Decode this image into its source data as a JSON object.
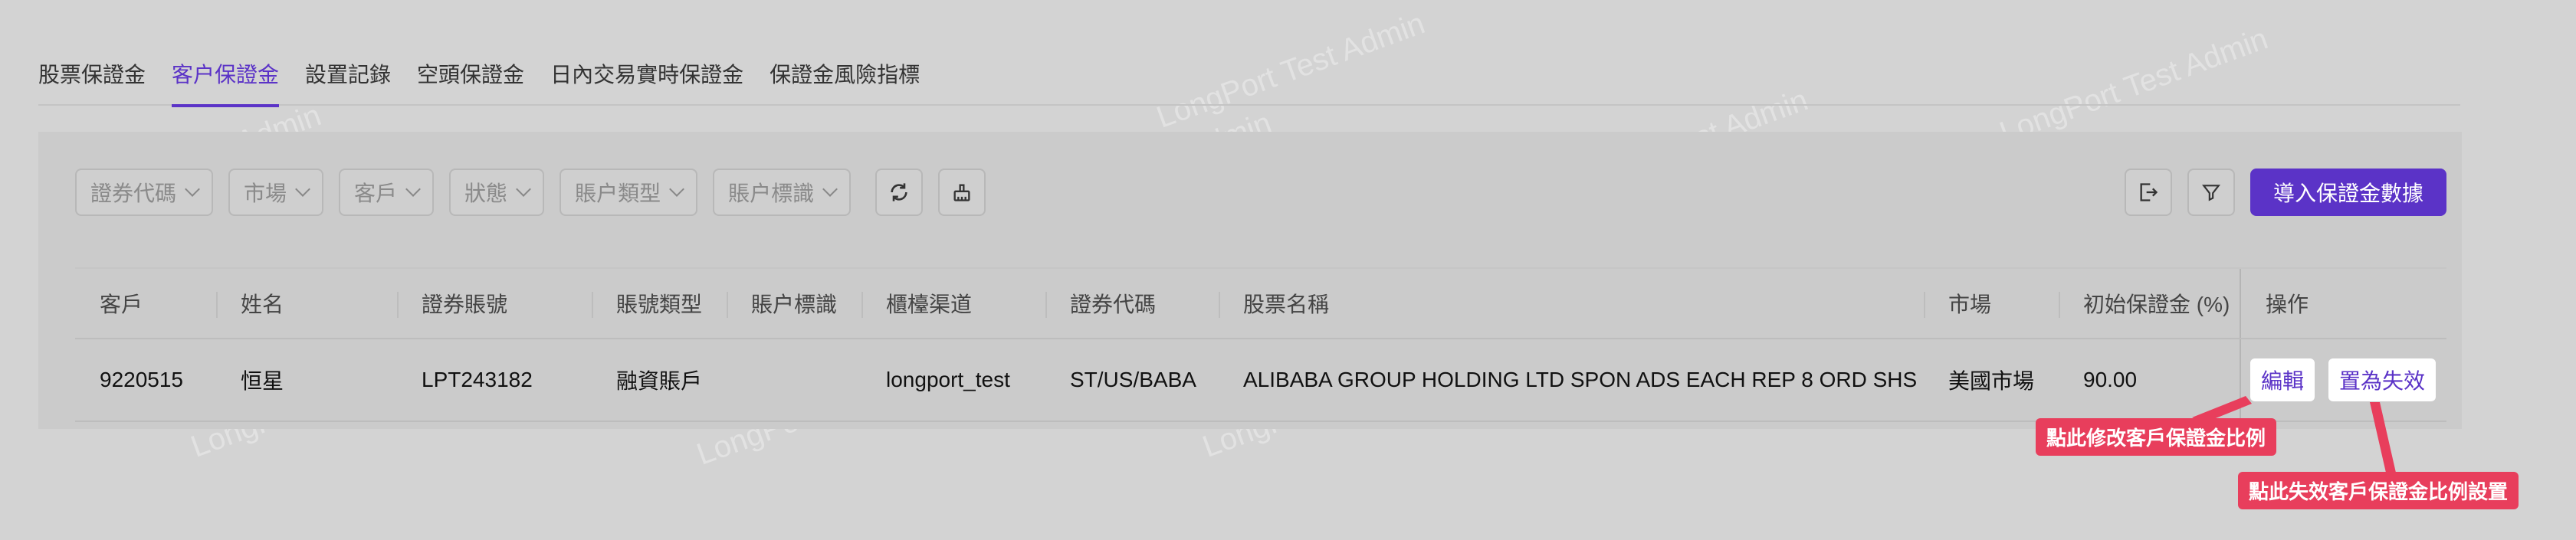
{
  "tabs": [
    "股票保證金",
    "客户保證金",
    "設置記錄",
    "空頭保證金",
    "日內交易實時保證金",
    "保證金風險指標"
  ],
  "active_tab": 1,
  "filters": [
    "證券代碼",
    "市場",
    "客戶",
    "狀態",
    "賬户類型",
    "賬户標識"
  ],
  "toolbar": {
    "import_label": "導入保證金數據"
  },
  "table": {
    "headers": [
      "客戶",
      "姓名",
      "證券賬號",
      "賬號類型",
      "賬户標識",
      "櫃檯渠道",
      "證券代碼",
      "股票名稱",
      "市場",
      "初始保證金 (%)",
      "操作"
    ],
    "rows": [
      {
        "customer": "9220515",
        "name": "恒星",
        "account": "LPT243182",
        "account_type": "融資賬戶",
        "account_tag": "",
        "channel": "longport_test",
        "symbol": "ST/US/BABA",
        "stock_name": "ALIBABA GROUP HOLDING LTD SPON ADS EACH REP 8 ORD SHS",
        "market": "美國市場",
        "initial_margin": "90.00",
        "actions": {
          "edit": "編輯",
          "invalidate": "置為失效"
        }
      }
    ]
  },
  "callouts": {
    "edit_hint": "點此修改客戶保證金比例",
    "invalidate_hint": "點此失效客戶保證金比例設置"
  },
  "watermark": "LongPort Test Admin",
  "colors": {
    "accent": "#5b33c7",
    "callout": "#e83e5c"
  }
}
